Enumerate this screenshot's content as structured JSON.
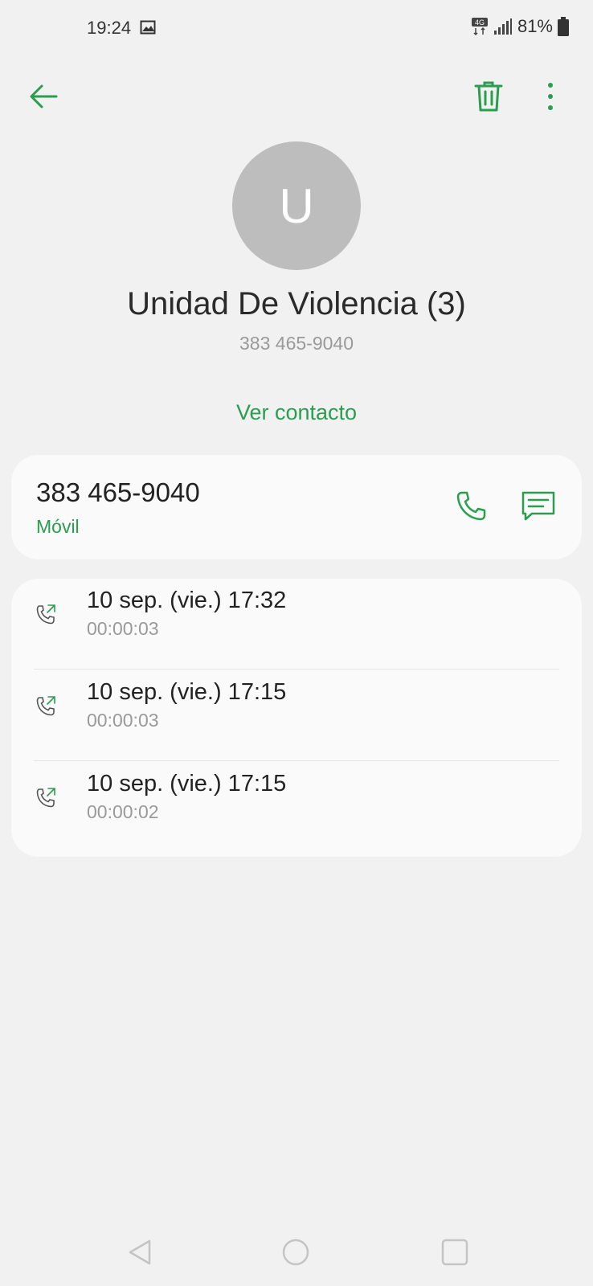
{
  "status_bar": {
    "time": "19:24",
    "network_badge": "4G",
    "battery": "81%",
    "icons": [
      "image-icon",
      "network-4g-icon",
      "signal-icon",
      "battery-icon"
    ]
  },
  "toolbar": {
    "back_icon": "back-arrow-icon",
    "delete_icon": "trash-icon",
    "more_icon": "more-vert-icon",
    "accent_color": "#2a9d4f"
  },
  "contact": {
    "avatar_letter": "U",
    "name": "Unidad De Violencia (3)",
    "number": "383 465-9040",
    "view_contact_label": "Ver contacto"
  },
  "number_card": {
    "number": "383 465-9040",
    "type": "Móvil",
    "call_icon": "phone-icon",
    "message_icon": "message-icon"
  },
  "history": [
    {
      "datetime": "10 sep. (vie.) 17:32",
      "duration": "00:00:03",
      "icon": "outgoing-call-icon"
    },
    {
      "datetime": "10 sep. (vie.) 17:15",
      "duration": "00:00:03",
      "icon": "outgoing-call-icon"
    },
    {
      "datetime": "10 sep. (vie.) 17:15",
      "duration": "00:00:02",
      "icon": "outgoing-call-icon"
    }
  ],
  "nav_bar": {
    "icons": [
      "nav-back-icon",
      "nav-home-icon",
      "nav-recents-icon"
    ]
  }
}
